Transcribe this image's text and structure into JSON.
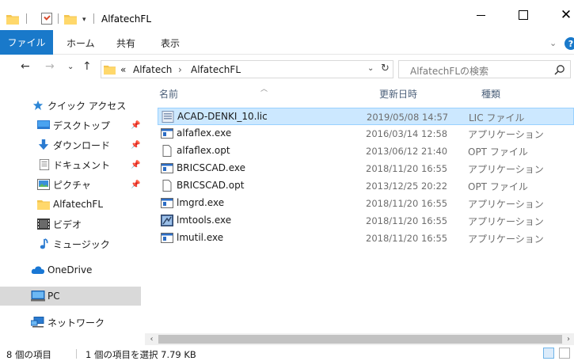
{
  "window": {
    "title": "AlfatechFL"
  },
  "ribbon": {
    "file_tab": "ファイル",
    "home_tab": "ホーム",
    "share_tab": "共有",
    "view_tab": "表示",
    "help_label": "?"
  },
  "address": {
    "overflow": "«",
    "crumb1": "Alfatech",
    "separator": "›",
    "crumb2": "AlfatechFL"
  },
  "search": {
    "placeholder": "AlfatechFLの検索"
  },
  "sidebar": {
    "items": [
      {
        "label": "クイック アクセス",
        "icon": "star-icon"
      },
      {
        "label": "デスクトップ",
        "icon": "desktop-icon",
        "pinned": true
      },
      {
        "label": "ダウンロード",
        "icon": "download-icon",
        "pinned": true
      },
      {
        "label": "ドキュメント",
        "icon": "document-icon",
        "pinned": true
      },
      {
        "label": "ピクチャ",
        "icon": "pictures-icon",
        "pinned": true
      },
      {
        "label": "AlfatechFL",
        "icon": "folder-icon"
      },
      {
        "label": "ビデオ",
        "icon": "video-icon"
      },
      {
        "label": "ミュージック",
        "icon": "music-icon"
      },
      {
        "label": "OneDrive",
        "icon": "cloud-icon"
      },
      {
        "label": "PC",
        "icon": "pc-icon",
        "selected": true
      },
      {
        "label": "ネットワーク",
        "icon": "network-icon"
      }
    ]
  },
  "columns": {
    "name": "名前",
    "date": "更新日時",
    "type": "種類"
  },
  "files": [
    {
      "name": "ACAD-DENKI_10.lic",
      "date": "2019/05/08 14:57",
      "type": "LIC ファイル",
      "icon": "license-file-icon",
      "selected": true
    },
    {
      "name": "alfaflex.exe",
      "date": "2016/03/14 12:58",
      "type": "アプリケーション",
      "icon": "exe-icon"
    },
    {
      "name": "alfaflex.opt",
      "date": "2013/06/12 21:40",
      "type": "OPT ファイル",
      "icon": "blank-file-icon"
    },
    {
      "name": "BRICSCAD.exe",
      "date": "2018/11/20 16:55",
      "type": "アプリケーション",
      "icon": "exe-icon"
    },
    {
      "name": "BRICSCAD.opt",
      "date": "2013/12/25 20:22",
      "type": "OPT ファイル",
      "icon": "blank-file-icon"
    },
    {
      "name": "lmgrd.exe",
      "date": "2018/11/20 16:55",
      "type": "アプリケーション",
      "icon": "exe-icon"
    },
    {
      "name": "lmtools.exe",
      "date": "2018/11/20 16:55",
      "type": "アプリケーション",
      "icon": "tools-exe-icon"
    },
    {
      "name": "lmutil.exe",
      "date": "2018/11/20 16:55",
      "type": "アプリケーション",
      "icon": "exe-icon"
    }
  ],
  "status": {
    "item_count": "8 個の項目",
    "selection": "1 個の項目を選択  7.79 KB"
  },
  "colors": {
    "accent": "#1979ca",
    "selection_bg": "#cce8ff",
    "selection_border": "#99d1ff",
    "folder": "#f3c44f"
  }
}
